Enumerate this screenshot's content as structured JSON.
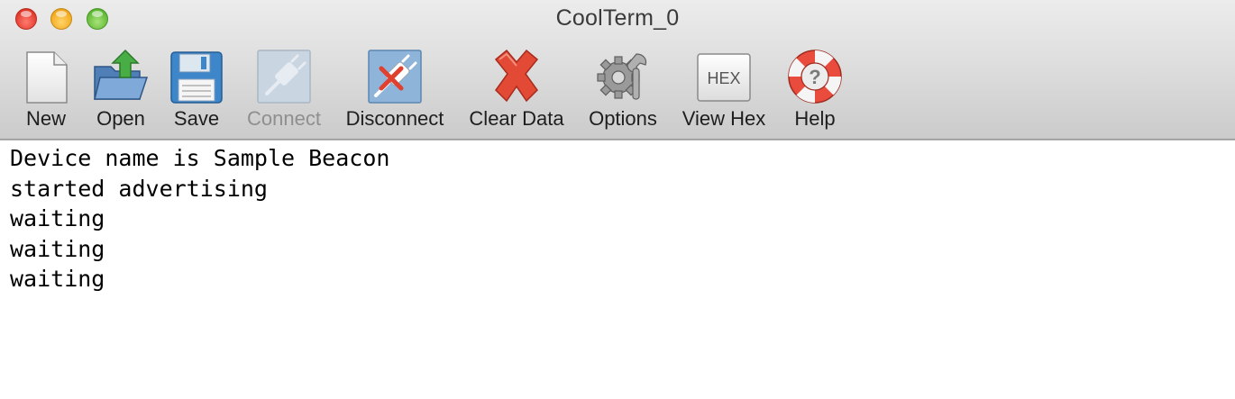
{
  "window": {
    "title": "CoolTerm_0"
  },
  "toolbar": {
    "items": [
      {
        "label": "New",
        "icon": "new-document-icon",
        "enabled": true
      },
      {
        "label": "Open",
        "icon": "open-folder-icon",
        "enabled": true
      },
      {
        "label": "Save",
        "icon": "floppy-disk-icon",
        "enabled": true
      },
      {
        "label": "Connect",
        "icon": "plug-icon",
        "enabled": false
      },
      {
        "label": "Disconnect",
        "icon": "unplug-icon",
        "enabled": true
      },
      {
        "label": "Clear Data",
        "icon": "red-x-icon",
        "enabled": true
      },
      {
        "label": "Options",
        "icon": "gear-wrench-icon",
        "enabled": true
      },
      {
        "label": "View Hex",
        "icon": "hex-icon",
        "enabled": true
      },
      {
        "label": "Help",
        "icon": "lifebuoy-help-icon",
        "enabled": true
      }
    ],
    "hex_icon_text": "HEX",
    "help_icon_text": "?"
  },
  "terminal": {
    "lines": [
      "Device name is Sample Beacon",
      "started advertising",
      "waiting",
      "waiting",
      "waiting"
    ]
  },
  "colors": {
    "close": "#e1392c",
    "minimize": "#f2a91c",
    "maximize": "#5fb934",
    "clear_x": "#e0402e",
    "open_arrow": "#3fa34a"
  }
}
